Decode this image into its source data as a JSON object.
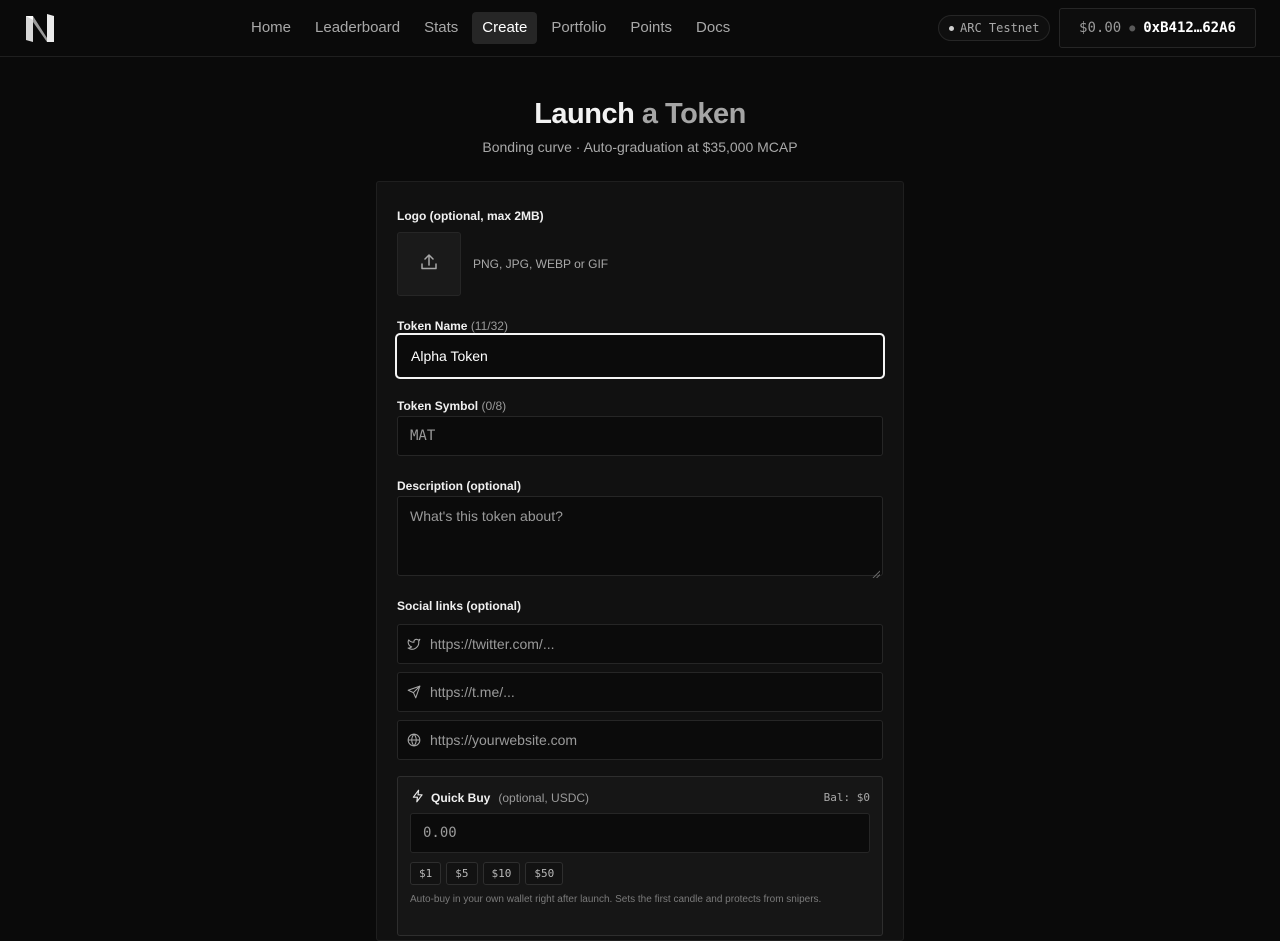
{
  "header": {
    "logo_icon": "n-logo-icon",
    "nav": [
      {
        "label": "Home",
        "active": false
      },
      {
        "label": "Leaderboard",
        "active": false
      },
      {
        "label": "Stats",
        "active": false
      },
      {
        "label": "Create",
        "active": true
      },
      {
        "label": "Portfolio",
        "active": false
      },
      {
        "label": "Points",
        "active": false
      },
      {
        "label": "Docs",
        "active": false
      }
    ],
    "network": "ARC Testnet",
    "wallet": {
      "balance": "$0.00",
      "address": "0xB412…62A6"
    }
  },
  "page": {
    "title_part1": "Launch",
    "title_part2": "a Token",
    "subtitle": "Bonding curve · Auto-graduation at $35,000 MCAP"
  },
  "form": {
    "logo": {
      "label": "Logo (optional, max 2MB)",
      "hint": "PNG, JPG, WEBP or GIF",
      "icon": "upload-icon"
    },
    "token_name": {
      "label": "Token Name",
      "counter": "(11/32)",
      "value": "Alpha Token"
    },
    "token_symbol": {
      "label": "Token Symbol",
      "counter": "(0/8)",
      "placeholder": "MAT"
    },
    "description": {
      "label": "Description (optional)",
      "placeholder": "What's this token about?"
    },
    "social": {
      "label": "Social links (optional)",
      "links": [
        {
          "icon": "twitter-icon",
          "placeholder": "https://twitter.com/..."
        },
        {
          "icon": "telegram-icon",
          "placeholder": "https://t.me/..."
        },
        {
          "icon": "globe-icon",
          "placeholder": "https://yourwebsite.com"
        }
      ]
    },
    "quick_buy": {
      "icon": "lightning-icon",
      "title": "Quick Buy",
      "subtitle": "(optional, USDC)",
      "balance": "Bal: $0",
      "placeholder": "0.00",
      "presets": [
        "$1",
        "$5",
        "$10",
        "$50"
      ],
      "note": "Auto-buy in your own wallet right after launch. Sets the first candle and protects from snipers."
    }
  }
}
